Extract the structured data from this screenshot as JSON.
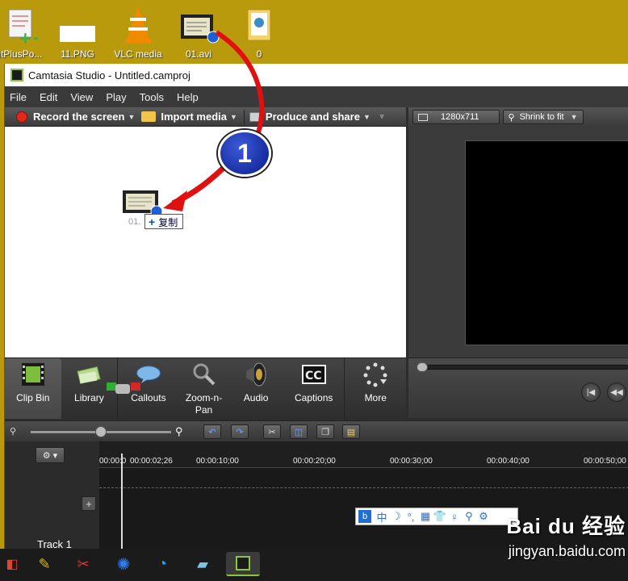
{
  "desktop": {
    "icons": [
      {
        "label": "litPlusPo..."
      },
      {
        "label": "11.PNG"
      },
      {
        "label": "VLC media"
      },
      {
        "label": "01.avi"
      },
      {
        "label": "0"
      }
    ]
  },
  "window": {
    "title": "Camtasia Studio - Untitled.camproj"
  },
  "menu": [
    "File",
    "Edit",
    "View",
    "Play",
    "Tools",
    "Help"
  ],
  "toolbar": {
    "record": "Record the screen",
    "import": "Import media",
    "produce": "Produce and share"
  },
  "clip_bin": {
    "drag_filename": "01.",
    "drag_tooltip": "复制",
    "drag_tooltip_symbol": "+"
  },
  "preview": {
    "resolution": "1280x711",
    "zoom_mode": "Shrink to fit"
  },
  "tabs": [
    "Clip Bin",
    "Library",
    "Callouts",
    "Zoom-n-Pan",
    "Audio",
    "Captions",
    "More"
  ],
  "timeline": {
    "ticks": [
      "00:00:0",
      "00:00:02;26",
      "00:00:10;00",
      "00:00:20;00",
      "00:00:30;00",
      "00:00:40;00",
      "00:00:50;00"
    ],
    "track_name": "Track 1"
  },
  "ime": [
    "中",
    "☽",
    "°,",
    "▦",
    "👕",
    "♀",
    "⚲",
    "⚙"
  ],
  "annotation": {
    "step_number": "1"
  },
  "watermark": {
    "brand": "Bai du 经验",
    "url": "jingyan.baidu.com"
  },
  "colors": {
    "desktop_bg": "#b89a0c",
    "arrow": "#e01010",
    "camtasia_green": "#8cc63f"
  }
}
